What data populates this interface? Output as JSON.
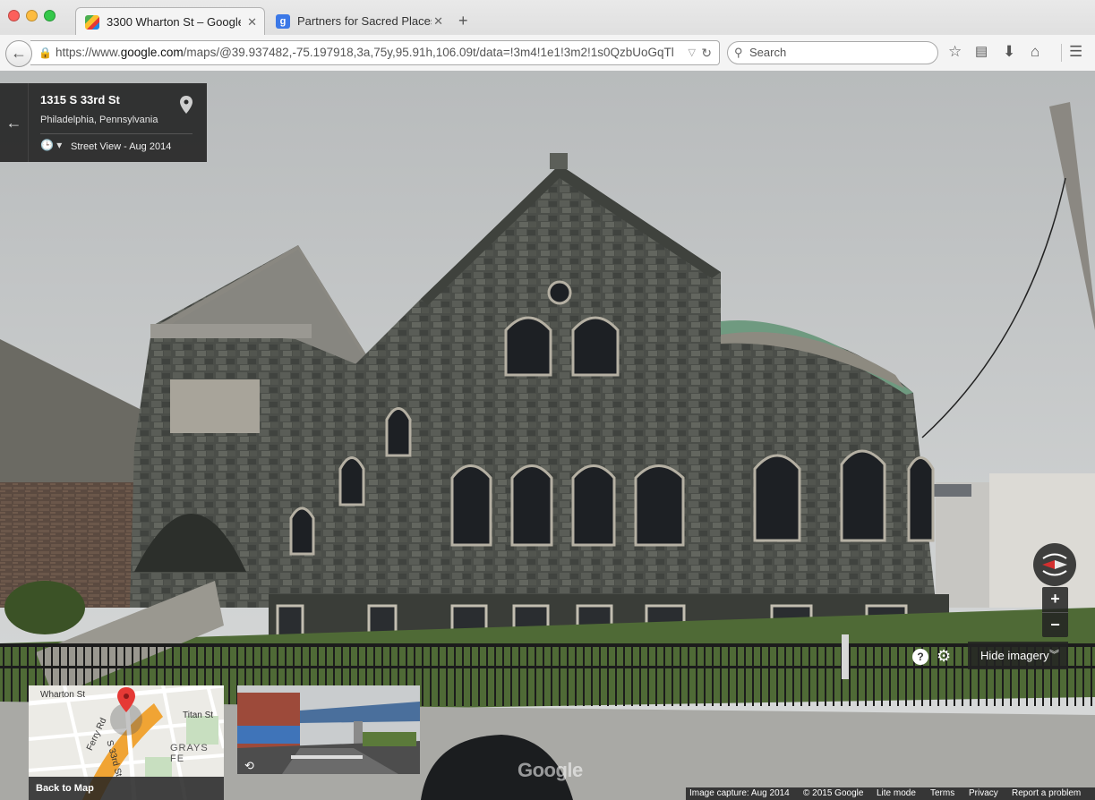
{
  "browser": {
    "tabs": [
      {
        "title": "3300 Wharton St – Google...",
        "active": true
      },
      {
        "title": "Partners for Sacred Places ...",
        "active": false
      }
    ],
    "new_tab": "+",
    "url": {
      "scheme": "https://www.",
      "domain": "google.com",
      "path": "/maps/@39.937482,-75.197918,3a,75y,95.91h,106.09t/data=!3m4!1e1!3m2!1s0QzbUoGqTl"
    },
    "search_placeholder": "Search"
  },
  "infocard": {
    "address": "1315 S 33rd St",
    "city": "Philadelphia, Pennsylvania",
    "imagery_date": "Street View - Aug 2014"
  },
  "controls": {
    "zoom_in": "+",
    "zoom_out": "−",
    "hide_imagery": "Hide imagery",
    "help": "?"
  },
  "minimap": {
    "back_to_map": "Back to Map",
    "labels": [
      "Wharton St",
      "Titan St",
      "S 33rd St",
      "GRAYS FE",
      "Ferry Rd"
    ]
  },
  "watermark": "Google",
  "footer": {
    "capture": "Image capture: Aug 2014",
    "copyright": "© 2015 Google",
    "lite": "Lite mode",
    "terms": "Terms",
    "privacy": "Privacy",
    "report": "Report a problem"
  },
  "colors": {
    "panel_bg": "#222222",
    "compass_red": "#d32f2f",
    "stone": "#4c4f4a",
    "sky": "#c9cccc",
    "roof_green": "#6f9a80",
    "grass": "#4f6a36"
  }
}
